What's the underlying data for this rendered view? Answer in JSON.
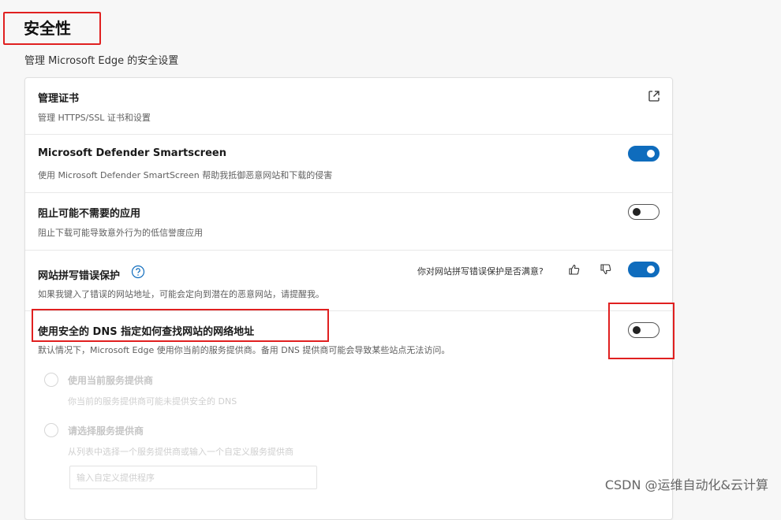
{
  "header": {
    "title": "安全性",
    "subtitle": "管理 Microsoft Edge 的安全设置"
  },
  "settings": {
    "certificates": {
      "title": "管理证书",
      "desc": "管理 HTTPS/SSL 证书和设置",
      "icon": "external-link-icon"
    },
    "smartscreen": {
      "title": "Microsoft Defender Smartscreen",
      "desc": "使用 Microsoft Defender SmartScreen 帮助我抵御恶意网站和下载的侵害",
      "enabled": true
    },
    "block_pua": {
      "title": "阻止可能不需要的应用",
      "desc": "阻止下载可能导致意外行为的低信誉度应用",
      "enabled": false
    },
    "typo_protection": {
      "title": "网站拼写错误保护",
      "desc": "如果我键入了错误的网站地址，可能会定向到潜在的恶意网站，请提醒我。",
      "feedback_question": "你对网站拼写错误保护是否满意?",
      "enabled": true
    },
    "secure_dns": {
      "title": "使用安全的 DNS 指定如何查找网站的网络地址",
      "desc": "默认情况下，Microsoft Edge 使用你当前的服务提供商。备用 DNS 提供商可能会导致某些站点无法访问。",
      "enabled": false,
      "options": [
        {
          "title": "使用当前服务提供商",
          "desc": "你当前的服务提供商可能未提供安全的 DNS"
        },
        {
          "title": "请选择服务提供商",
          "desc": "从列表中选择一个服务提供商或输入一个自定义服务提供商"
        }
      ],
      "custom_placeholder": "输入自定义提供程序"
    }
  },
  "watermark": "CSDN @运维自动化&云计算",
  "colors": {
    "accent": "#0f6cbd",
    "highlight_box": "#e02020"
  }
}
